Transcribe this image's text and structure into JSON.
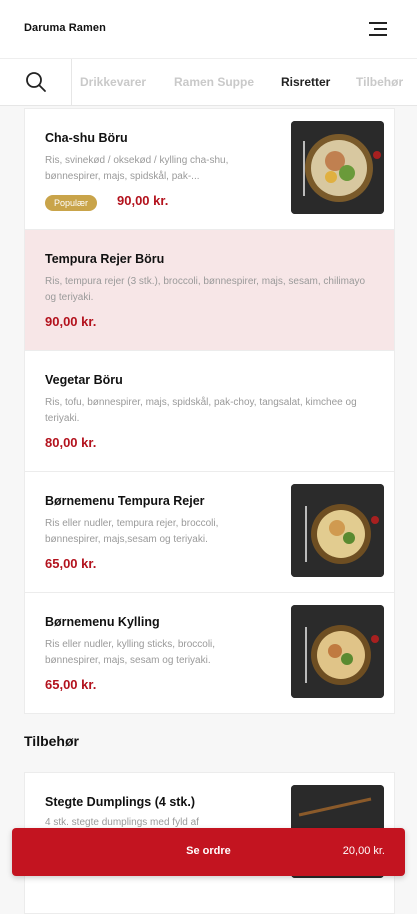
{
  "app": {
    "brand": "Daruma Ramen"
  },
  "header": {
    "menu_icon": "hamburger-menu-icon"
  },
  "tabs": [
    {
      "label": "Drikkevarer",
      "active": false
    },
    {
      "label": "Ramen Suppe",
      "active": false
    },
    {
      "label": "Risretter",
      "active": true
    },
    {
      "label": "Tilbehør",
      "active": false
    }
  ],
  "items": [
    {
      "name": "Cha-shu Böru",
      "description": "Ris, svinekød / oksekød / kylling cha-shu, bønnespirer, majs, spidskål, pak-...",
      "badge": "Populær",
      "price": "90,00 kr.",
      "has_image": true
    },
    {
      "name": "Tempura Rejer Böru",
      "description": "Ris, tempura rejer (3 stk.), broccoli, bønnespirer, majs, sesam, chilimayo og teriyaki.",
      "price": "90,00 kr.",
      "highlighted": true,
      "has_image": false
    },
    {
      "name": "Vegetar Böru",
      "description": "Ris, tofu, bønnespirer, majs, spidskål, pak-choy, tangsalat, kimchee og teriyaki.",
      "price": "80,00 kr.",
      "has_image": false
    },
    {
      "name": "Børnemenu Tempura Rejer",
      "description": "Ris eller nudler, tempura rejer, broccoli, bønnespirer, majs,sesam og teriyaki.",
      "price": "65,00 kr.",
      "has_image": true
    },
    {
      "name": "Børnemenu Kylling",
      "description": "Ris eller nudler, kylling sticks, broccoli, bønnespirer, majs, sesam og teriyaki.",
      "price": "65,00 kr.",
      "has_image": true
    }
  ],
  "section2": {
    "title": "Tilbehør",
    "items": [
      {
        "name": "Stegte Dumplings (4 stk.)",
        "description": "4 stk. stegte dumplings med fyld af"
      }
    ]
  },
  "order": {
    "label": "Se ordre",
    "total": "20,00 kr."
  },
  "colors": {
    "accent": "#c31420",
    "badge": "#c9a44a",
    "highlight": "#f7e6e7"
  }
}
